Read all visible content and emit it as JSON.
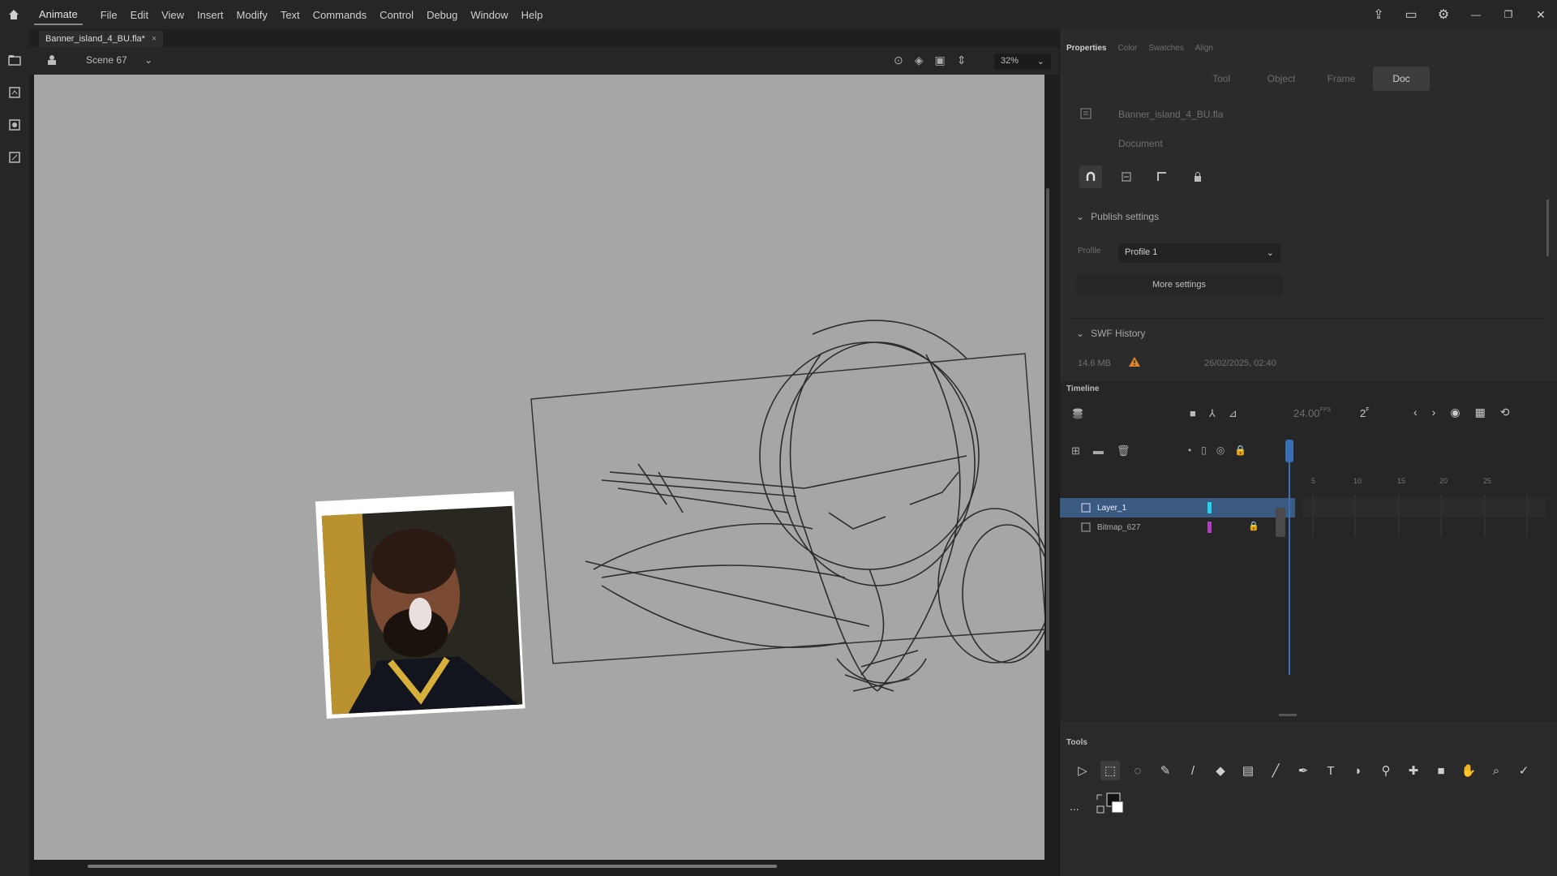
{
  "menubar": {
    "app_name": "Animate",
    "items": [
      "File",
      "Edit",
      "View",
      "Insert",
      "Modify",
      "Text",
      "Commands",
      "Control",
      "Debug",
      "Window",
      "Help"
    ]
  },
  "document": {
    "tab_name": "Banner_island_4_BU.fla*",
    "scene": "Scene 67",
    "zoom": "32%"
  },
  "properties": {
    "panel_tabs": [
      "Properties",
      "Color",
      "Swatches",
      "Align"
    ],
    "sub_tabs": [
      "Tool",
      "Object",
      "Frame",
      "Doc"
    ],
    "active_sub_tab": "Doc",
    "file_name": "Banner_island_4_BU.fla",
    "doc_type": "Document",
    "publish_settings_label": "Publish settings",
    "profile_label": "Profile",
    "profile_value": "Profile 1",
    "more_settings": "More settings",
    "swf_history_label": "SWF History",
    "swf_size": "14.6 MB",
    "swf_date": "26/02/2025, 02:40"
  },
  "timeline": {
    "title": "Timeline",
    "fps": "24.00",
    "fps_unit": "FPS",
    "frame": "2",
    "frame_ruler": [
      "5",
      "10",
      "15",
      "20",
      "25"
    ],
    "layers": [
      {
        "name": "Layer_1",
        "color": "#22d3ee",
        "selected": true
      },
      {
        "name": "Bitmap_627",
        "color": "#b040c0",
        "selected": false,
        "locked": true
      }
    ]
  },
  "tools": {
    "title": "Tools",
    "icons": [
      "selection-tool",
      "free-transform-tool",
      "lasso-tool",
      "paint-brush-tool",
      "brush-tool",
      "eraser-tool",
      "rectangle-tool",
      "line-tool",
      "pen-tool",
      "text-tool",
      "paint-bucket-tool",
      "eyedropper-tool",
      "pin-tool",
      "camera-tool",
      "hand-tool",
      "zoom-tool",
      "asset-warp-tool"
    ],
    "more": "..."
  },
  "colors": {
    "accent": "#3a5a82",
    "stage": "#a6a6a6",
    "warning": "#e0862a"
  }
}
